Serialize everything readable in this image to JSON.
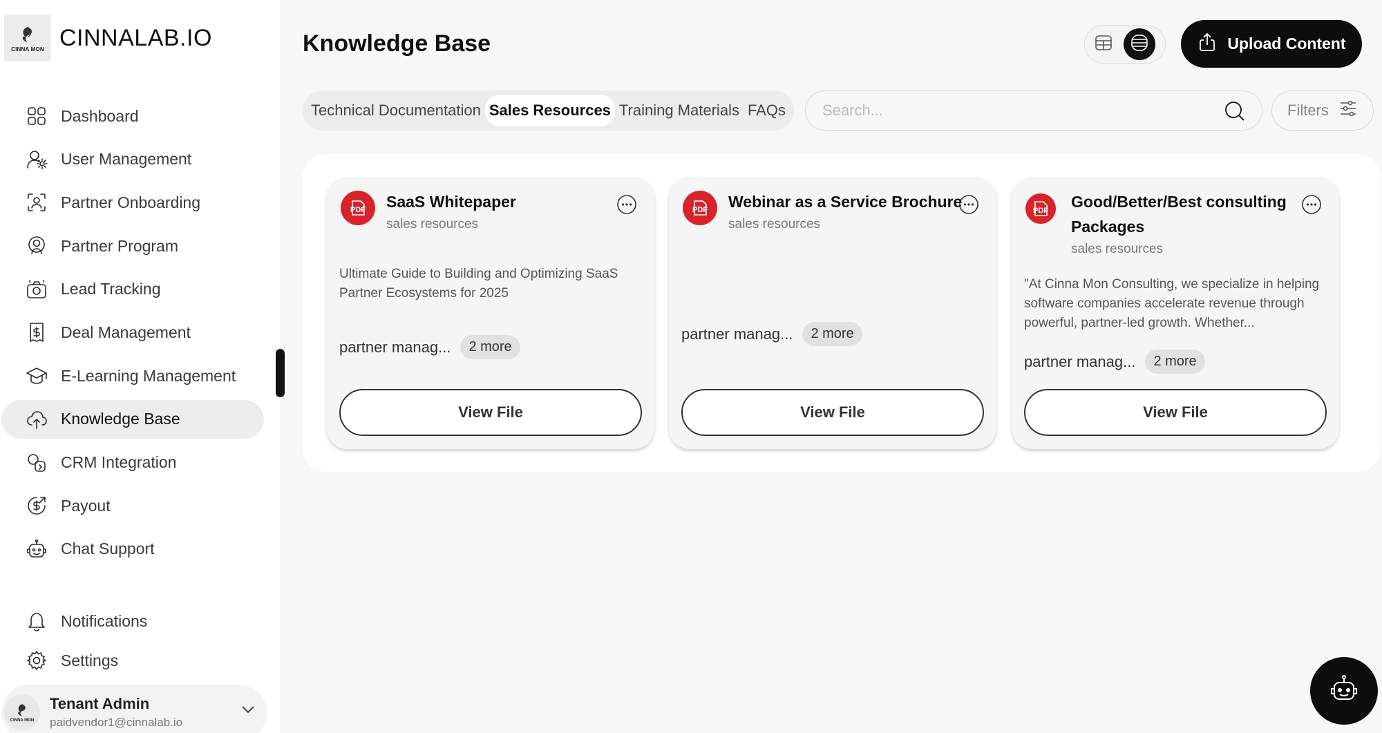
{
  "brand": {
    "name": "CINNALAB.IO",
    "logo_text": "CINNA MON"
  },
  "sidebar": {
    "items": [
      {
        "label": "Dashboard",
        "icon": "grid-icon"
      },
      {
        "label": "User Management",
        "icon": "user-gear-icon"
      },
      {
        "label": "Partner Onboarding",
        "icon": "face-scan-icon"
      },
      {
        "label": "Partner Program",
        "icon": "user-badge-icon"
      },
      {
        "label": "Lead Tracking",
        "icon": "camera-icon"
      },
      {
        "label": "Deal Management",
        "icon": "invoice-icon"
      },
      {
        "label": "E-Learning Management",
        "icon": "graduation-cap-icon"
      },
      {
        "label": "Knowledge Base",
        "icon": "cloud-upload-icon",
        "active": true
      },
      {
        "label": "CRM Integration",
        "icon": "integration-icon"
      },
      {
        "label": "Payout",
        "icon": "dollar-circle-icon"
      },
      {
        "label": "Chat Support",
        "icon": "robot-icon"
      }
    ],
    "bottom_items": [
      {
        "label": "Notifications",
        "icon": "bell-icon"
      },
      {
        "label": "Settings",
        "icon": "gear-icon"
      }
    ]
  },
  "user": {
    "name": "Tenant Admin",
    "email": "paidvendor1@cinnalab.io"
  },
  "header": {
    "title": "Knowledge Base",
    "upload_label": "Upload Content"
  },
  "tabs": [
    {
      "label": "Technical Documentation",
      "active": false
    },
    {
      "label": "Sales Resources",
      "active": true
    },
    {
      "label": "Training Materials",
      "active": false
    },
    {
      "label": "FAQs",
      "active": false
    }
  ],
  "search": {
    "placeholder": "Search...",
    "value": ""
  },
  "filters": {
    "label": "Filters"
  },
  "cards": [
    {
      "title": "SaaS Whitepaper",
      "category": "sales resources",
      "description": "Ultimate Guide to Building and Optimizing SaaS Partner Ecosystems for 2025",
      "tag": "partner manag...",
      "more": "2 more",
      "button": "View File"
    },
    {
      "title": "Webinar as a Service Brochure",
      "category": "sales resources",
      "description": "",
      "tag": "partner manag...",
      "more": "2 more",
      "button": "View File"
    },
    {
      "title": "Good/Better/Best consulting Packages",
      "category": "sales resources",
      "description": "\"At Cinna Mon Consulting, we specialize in helping software companies accelerate revenue through powerful, partner-led growth. Whether...",
      "tag": "partner manag...",
      "more": "2 more",
      "button": "View File"
    }
  ],
  "colors": {
    "accent": "#0d0d0d",
    "pdf_red": "#d8232a",
    "active_nav": "#ededed"
  }
}
